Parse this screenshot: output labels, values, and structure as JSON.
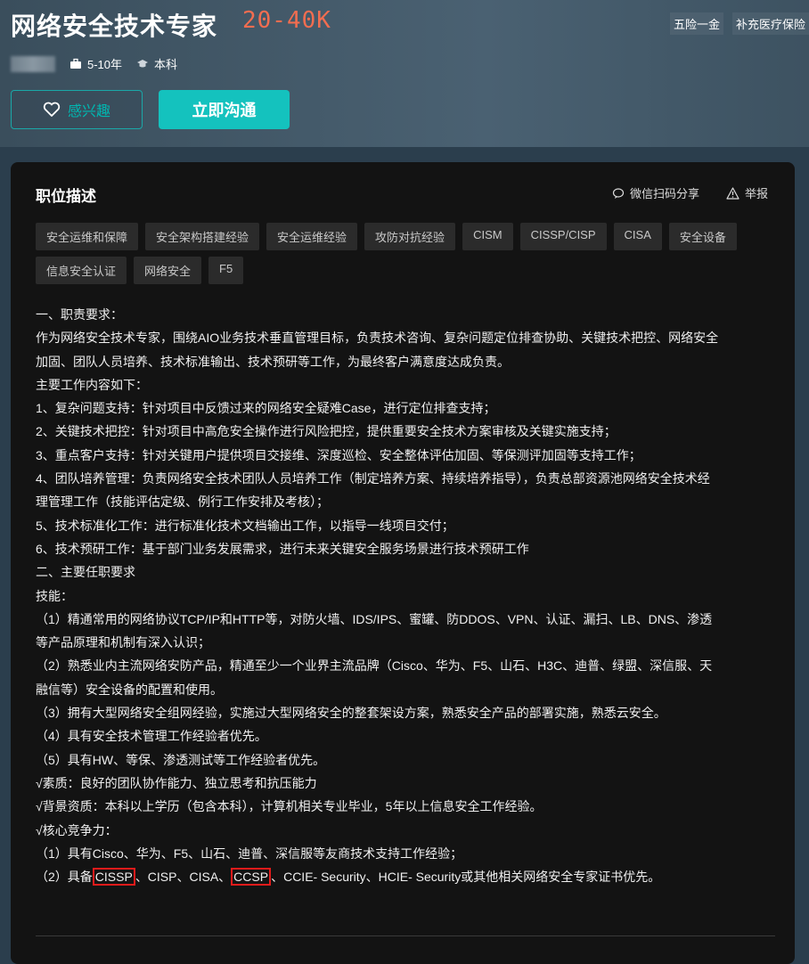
{
  "header": {
    "title": "网络安全技术专家",
    "salary": "20-40K",
    "benefits": [
      "五险一金",
      "补充医疗保险"
    ],
    "experience": "5-10年",
    "education": "本科",
    "interest_label": "感兴趣",
    "chat_label": "立即沟通"
  },
  "panel": {
    "title": "职位描述",
    "share_label": "微信扫码分享",
    "report_label": "举报",
    "tags": [
      "安全运维和保障",
      "安全架构搭建经验",
      "安全运维经验",
      "攻防对抗经验",
      "CISM",
      "CISSP/CISP",
      "CISA",
      "安全设备",
      "信息安全认证",
      "网络安全",
      "F5"
    ]
  },
  "description": {
    "lines": [
      "一、职责要求：",
      "作为网络安全技术专家，围绕AIO业务技术垂直管理目标，负责技术咨询、复杂问题定位排查协助、关键技术把控、网络安全",
      "加固、团队人员培养、技术标准输出、技术预研等工作，为最终客户满意度达成负责。",
      "主要工作内容如下：",
      "1、复杂问题支持：针对项目中反馈过来的网络安全疑难Case，进行定位排查支持；",
      "2、关键技术把控：针对项目中高危安全操作进行风险把控，提供重要安全技术方案审核及关键实施支持；",
      "3、重点客户支持：针对关键用户提供项目交接维、深度巡检、安全整体评估加固、等保测评加固等支持工作；",
      "4、团队培养管理：负责网络安全技术团队人员培养工作（制定培养方案、持续培养指导），负责总部资源池网络安全技术经",
      "理管理工作（技能评估定级、例行工作安排及考核）；",
      "5、技术标准化工作：进行标准化技术文档输出工作，以指导一线项目交付；",
      "6、技术预研工作：基于部门业务发展需求，进行未来关键安全服务场景进行技术预研工作",
      "二、主要任职要求",
      "技能：",
      "（1）精通常用的网络协议TCP/IP和HTTP等，对防火墙、IDS/IPS、蜜罐、防DDOS、VPN、认证、漏扫、LB、DNS、渗透",
      "等产品原理和机制有深入认识；",
      "（2）熟悉业内主流网络安防产品，精通至少一个业界主流品牌（Cisco、华为、F5、山石、H3C、迪普、绿盟、深信服、天",
      "融信等）安全设备的配置和使用。",
      "（3）拥有大型网络安全组网经验，实施过大型网络安全的整套架设方案，熟悉安全产品的部署实施，熟悉云安全。",
      "（4）具有安全技术管理工作经验者优先。",
      "（5）具有HW、等保、渗透测试等工作经验者优先。",
      "√素质：良好的团队协作能力、独立思考和抗压能力",
      "√背景资质：本科以上学历（包含本科），计算机相关专业毕业，5年以上信息安全工作经验。",
      "√核心竞争力：",
      "（1）具有Cisco、华为、F5、山石、迪普、深信服等友商技术支持工作经验；"
    ],
    "last": {
      "prefix": "（2）具备",
      "hl1": "CISSP",
      "mid": "、CISP、CISA、",
      "hl2": "CCSP",
      "suffix": "、CCIE- Security、HCIE- Security或其他相关网络安全专家证书优先。"
    }
  }
}
